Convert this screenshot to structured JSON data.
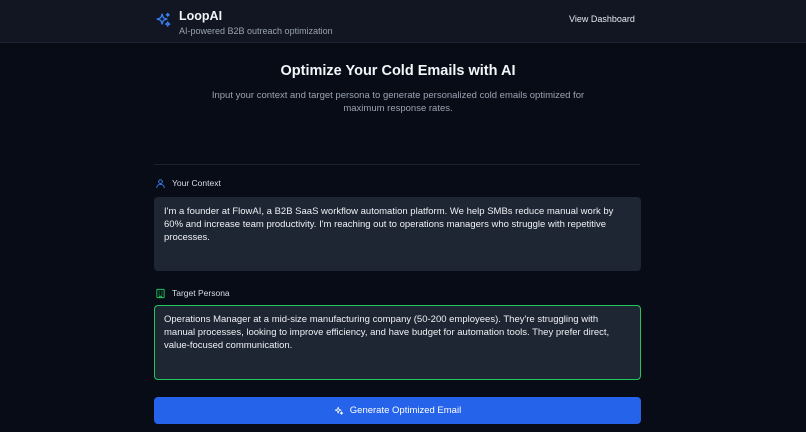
{
  "header": {
    "brand_name": "LoopAI",
    "tagline": "AI-powered B2B outreach optimization",
    "nav_link": "View Dashboard",
    "logo_icon": "sparkles-icon"
  },
  "hero": {
    "title": "Optimize Your Cold Emails with AI",
    "subtitle": "Input your context and target persona to generate personalized cold emails optimized for maximum response rates."
  },
  "form": {
    "context": {
      "label": "Your Context",
      "icon": "user-icon",
      "value": "I'm a founder at FlowAI, a B2B SaaS workflow automation platform. We help SMBs reduce manual work by 60% and increase team productivity. I'm reaching out to operations managers who struggle with repetitive processes."
    },
    "persona": {
      "label": "Target Persona",
      "icon": "building-icon",
      "value": "Operations Manager at a mid-size manufacturing company (50-200 employees). They're struggling with manual processes, looking to improve efficiency, and have budget for automation tools. They prefer direct, value-focused communication."
    },
    "submit_label": "Generate Optimized Email",
    "submit_icon": "sparkles-icon"
  },
  "colors": {
    "background": "#080c17",
    "header": "#111622",
    "field": "#1f2633",
    "accent": "#2563eb",
    "focus": "#22c55e",
    "icon": "#3b82f6"
  }
}
